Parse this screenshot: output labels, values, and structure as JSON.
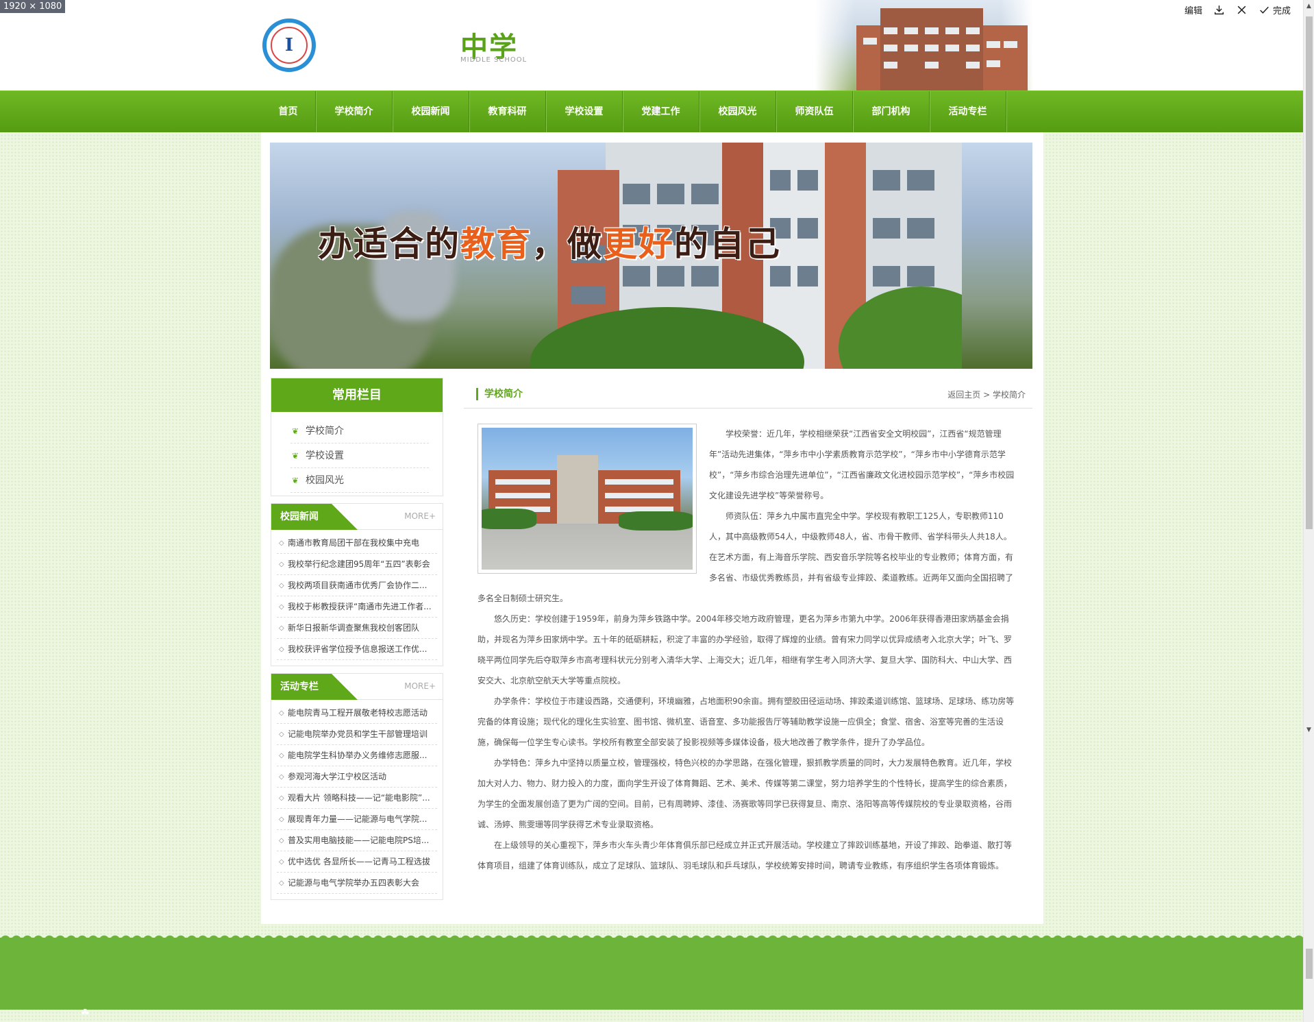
{
  "viewer": {
    "dimensions_label": "1920 × 1080",
    "edit_label": "编辑",
    "done_label": "完成"
  },
  "header": {
    "title": "中学",
    "subtitle": "MIDDLE SCHOOL"
  },
  "nav": {
    "items": [
      "首页",
      "学校简介",
      "校园新闻",
      "教育科研",
      "学校设置",
      "党建工作",
      "校园风光",
      "师资队伍",
      "部门机构",
      "活动专栏"
    ]
  },
  "banner": {
    "slogan_parts": [
      "办适合的",
      "教育",
      "，做",
      "更好",
      "的自己"
    ]
  },
  "sidebar": {
    "quick": {
      "title": "常用栏目",
      "items": [
        "学校简介",
        "学校设置",
        "校园风光"
      ]
    },
    "news": {
      "title": "校园新闻",
      "more": "MORE+",
      "items": [
        "南通市教育局团干部在我校集中充电",
        "我校举行纪念建团95周年“五四”表彰会",
        "我校两项目获南通市优秀厂会协作二...",
        "我校于彬教授获评“南通市先进工作者...",
        "新华日报新华调查聚焦我校创客团队",
        "我校获评省学位授予信息报送工作优..."
      ]
    },
    "activity": {
      "title": "活动专栏",
      "more": "MORE+",
      "items": [
        "能电院青马工程开展敬老特校志愿活动",
        "记能电院举办党员和学生干部管理培训",
        "能电院学生科协举办义务维修志愿服...",
        "参观河海大学江宁校区活动",
        "观看大片 领略科技——记“能电影院”...",
        "展现青年力量——记能源与电气学院...",
        "普及实用电脑技能——记能电院PS培...",
        "优中选优 各显所长——记青马工程选拔",
        "记能源与电气学院举办五四表彰大会"
      ]
    }
  },
  "main": {
    "section_title": "学校简介",
    "breadcrumb": {
      "home": "返回主页",
      "sep": ">",
      "current": "学校简介"
    },
    "paragraphs": [
      "学校荣誉：近几年，学校相继荣获“江西省安全文明校园”，江西省“规范管理年”活动先进集体，“萍乡市中小学素质教育示范学校”，“萍乡市中小学德育示范学校”，“萍乡市综合治理先进单位”，“江西省廉政文化进校园示范学校”，“萍乡市校园文化建设先进学校”等荣誉称号。",
      "师资队伍：萍乡九中属市直完全中学。学校现有教职工125人，专职教师110人，其中高级教师54人，中级教师48人，省、市骨干教师、省学科带头人共18人。在艺术方面，有上海音乐学院、西安音乐学院等名校毕业的专业教师；体育方面，有多名省、市级优秀教练员，并有省级专业摔跤、柔道教练。近两年又面向全国招聘了多名全日制硕士研究生。",
      "悠久历史：学校创建于1959年，前身为萍乡铁路中学。2004年移交地方政府管理，更名为萍乡市第九中学。2006年获得香港田家炳基金会捐助，并现名为萍乡田家炳中学。五十年的砥砺耕耘，积淀了丰富的办学经验，取得了辉煌的业绩。曾有宋力同学以优异成绩考入北京大学；叶飞、罗晓平两位同学先后夺取萍乡市高考理科状元分别考入清华大学、上海交大；近几年，相继有学生考入同济大学、复旦大学、国防科大、中山大学、西安交大、北京航空航天大学等重点院校。",
      "办学条件：学校位于市建设西路，交通便利，环境幽雅，占地面积90余亩。拥有塑胶田径运动场、摔跤柔道训练馆、篮球场、足球场、练功房等完备的体育设施；现代化的理化生实验室、图书馆、微机室、语音室、多功能报告厅等辅助教学设施一应俱全；食堂、宿舍、浴室等完善的生活设施，确保每一位学生专心读书。学校所有教室全部安装了投影视频等多媒体设备，极大地改善了教学条件，提升了办学品位。",
      "办学特色：萍乡九中坚持以质量立校，管理强校，特色兴校的办学思路，在强化管理，狠抓教学质量的同时，大力发展特色教育。近几年，学校加大对人力、物力、财力投入的力度，面向学生开设了体育舞蹈、艺术、美术、传媒等第二课堂，努力培养学生的个性特长，提高学生的综合素质，为学生的全面发展创造了更为广阔的空间。目前，已有周聘婷、漆佳、汤赛歌等同学已获得复旦、南京、洛阳等高等传媒院校的专业录取资格，谷雨诚、汤婷、熊雯珊等同学获得艺术专业录取资格。",
      "在上级领导的关心重视下，萍乡市火车头青少年体育俱乐部已经成立并正式开展活动。学校建立了摔跤训练基地，开设了摔跤、跆拳道、散打等体育项目，组建了体育训练队，成立了足球队、篮球队、羽毛球队和乒乓球队，学校统筹安排时间，聘请专业教练，有序组织学生各项体育锻炼。"
    ]
  },
  "colors": {
    "brand_green": "#5fa819",
    "accent_orange": "#e8601c"
  },
  "icons": {
    "toolbar": [
      "download-icon",
      "close-icon",
      "check-icon"
    ],
    "quick_bullet": "leaf-icon",
    "news_bullet": "diamond-bullet-icon"
  }
}
